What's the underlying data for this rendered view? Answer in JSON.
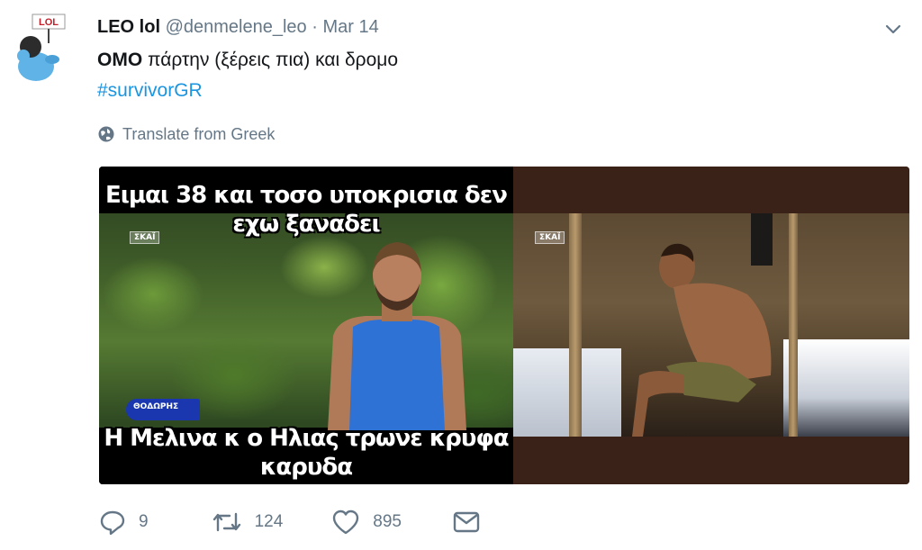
{
  "user": {
    "name": "LEO lol",
    "handle": "@denmelene_leo",
    "separator": "·",
    "date": "Mar 14",
    "avatar_badge": "LOL"
  },
  "tweet": {
    "text_bold": "ΟΜΟ",
    "text_rest": " πάρτην (ξέρεις πια) και δρομο",
    "hashtag": "#survivorGR",
    "translate_label": "Translate from Greek"
  },
  "media": {
    "caption_top_line1": "Ειμαι 38 και τοσο υποκρισια δεν",
    "caption_top_line2": "εχω ξαναδει",
    "caption_bottom_line1": "Η Μελινα κ ο Ηλιας τρωνε κρυφα",
    "caption_bottom_line2": "καρυδα",
    "channel_logo_left": "ΣΚΑΪ",
    "channel_logo_right": "ΣΚΑΪ",
    "sponsor_tag": "ΘΟΔΩΡΗΣ"
  },
  "actions": {
    "reply_count": "9",
    "retweet_count": "124",
    "like_count": "895"
  },
  "colors": {
    "link": "#1b95e0",
    "muted": "#657786",
    "text": "#14171a"
  }
}
